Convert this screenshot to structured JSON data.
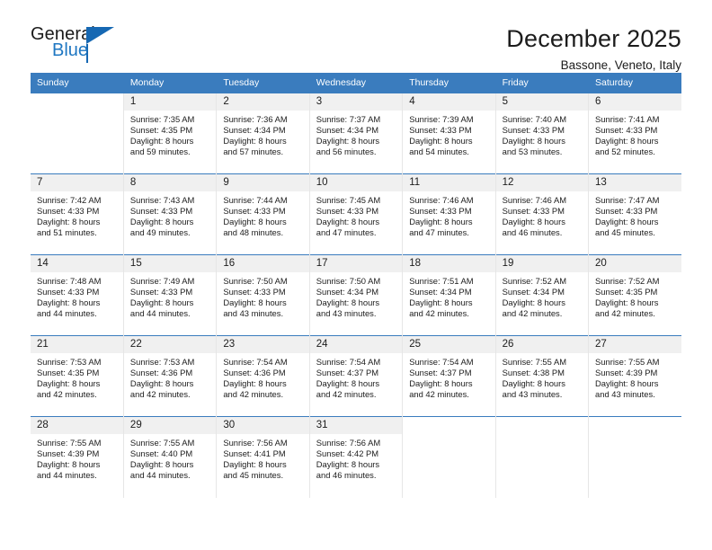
{
  "brand": {
    "name_part1": "General",
    "name_part2": "Blue",
    "triangle_color": "#1668b3",
    "blue_color": "#1f77c2"
  },
  "header": {
    "month_title": "December 2025",
    "location": "Bassone, Veneto, Italy",
    "header_bg": "#3a7cbe",
    "header_text_color": "#ffffff"
  },
  "weekdays": [
    "Sunday",
    "Monday",
    "Tuesday",
    "Wednesday",
    "Thursday",
    "Friday",
    "Saturday"
  ],
  "weeks": [
    [
      {
        "day": "",
        "sunrise": "",
        "sunset": "",
        "daylight1": "",
        "daylight2": ""
      },
      {
        "day": "1",
        "sunrise": "Sunrise: 7:35 AM",
        "sunset": "Sunset: 4:35 PM",
        "daylight1": "Daylight: 8 hours",
        "daylight2": "and 59 minutes."
      },
      {
        "day": "2",
        "sunrise": "Sunrise: 7:36 AM",
        "sunset": "Sunset: 4:34 PM",
        "daylight1": "Daylight: 8 hours",
        "daylight2": "and 57 minutes."
      },
      {
        "day": "3",
        "sunrise": "Sunrise: 7:37 AM",
        "sunset": "Sunset: 4:34 PM",
        "daylight1": "Daylight: 8 hours",
        "daylight2": "and 56 minutes."
      },
      {
        "day": "4",
        "sunrise": "Sunrise: 7:39 AM",
        "sunset": "Sunset: 4:33 PM",
        "daylight1": "Daylight: 8 hours",
        "daylight2": "and 54 minutes."
      },
      {
        "day": "5",
        "sunrise": "Sunrise: 7:40 AM",
        "sunset": "Sunset: 4:33 PM",
        "daylight1": "Daylight: 8 hours",
        "daylight2": "and 53 minutes."
      },
      {
        "day": "6",
        "sunrise": "Sunrise: 7:41 AM",
        "sunset": "Sunset: 4:33 PM",
        "daylight1": "Daylight: 8 hours",
        "daylight2": "and 52 minutes."
      }
    ],
    [
      {
        "day": "7",
        "sunrise": "Sunrise: 7:42 AM",
        "sunset": "Sunset: 4:33 PM",
        "daylight1": "Daylight: 8 hours",
        "daylight2": "and 51 minutes."
      },
      {
        "day": "8",
        "sunrise": "Sunrise: 7:43 AM",
        "sunset": "Sunset: 4:33 PM",
        "daylight1": "Daylight: 8 hours",
        "daylight2": "and 49 minutes."
      },
      {
        "day": "9",
        "sunrise": "Sunrise: 7:44 AM",
        "sunset": "Sunset: 4:33 PM",
        "daylight1": "Daylight: 8 hours",
        "daylight2": "and 48 minutes."
      },
      {
        "day": "10",
        "sunrise": "Sunrise: 7:45 AM",
        "sunset": "Sunset: 4:33 PM",
        "daylight1": "Daylight: 8 hours",
        "daylight2": "and 47 minutes."
      },
      {
        "day": "11",
        "sunrise": "Sunrise: 7:46 AM",
        "sunset": "Sunset: 4:33 PM",
        "daylight1": "Daylight: 8 hours",
        "daylight2": "and 47 minutes."
      },
      {
        "day": "12",
        "sunrise": "Sunrise: 7:46 AM",
        "sunset": "Sunset: 4:33 PM",
        "daylight1": "Daylight: 8 hours",
        "daylight2": "and 46 minutes."
      },
      {
        "day": "13",
        "sunrise": "Sunrise: 7:47 AM",
        "sunset": "Sunset: 4:33 PM",
        "daylight1": "Daylight: 8 hours",
        "daylight2": "and 45 minutes."
      }
    ],
    [
      {
        "day": "14",
        "sunrise": "Sunrise: 7:48 AM",
        "sunset": "Sunset: 4:33 PM",
        "daylight1": "Daylight: 8 hours",
        "daylight2": "and 44 minutes."
      },
      {
        "day": "15",
        "sunrise": "Sunrise: 7:49 AM",
        "sunset": "Sunset: 4:33 PM",
        "daylight1": "Daylight: 8 hours",
        "daylight2": "and 44 minutes."
      },
      {
        "day": "16",
        "sunrise": "Sunrise: 7:50 AM",
        "sunset": "Sunset: 4:33 PM",
        "daylight1": "Daylight: 8 hours",
        "daylight2": "and 43 minutes."
      },
      {
        "day": "17",
        "sunrise": "Sunrise: 7:50 AM",
        "sunset": "Sunset: 4:34 PM",
        "daylight1": "Daylight: 8 hours",
        "daylight2": "and 43 minutes."
      },
      {
        "day": "18",
        "sunrise": "Sunrise: 7:51 AM",
        "sunset": "Sunset: 4:34 PM",
        "daylight1": "Daylight: 8 hours",
        "daylight2": "and 42 minutes."
      },
      {
        "day": "19",
        "sunrise": "Sunrise: 7:52 AM",
        "sunset": "Sunset: 4:34 PM",
        "daylight1": "Daylight: 8 hours",
        "daylight2": "and 42 minutes."
      },
      {
        "day": "20",
        "sunrise": "Sunrise: 7:52 AM",
        "sunset": "Sunset: 4:35 PM",
        "daylight1": "Daylight: 8 hours",
        "daylight2": "and 42 minutes."
      }
    ],
    [
      {
        "day": "21",
        "sunrise": "Sunrise: 7:53 AM",
        "sunset": "Sunset: 4:35 PM",
        "daylight1": "Daylight: 8 hours",
        "daylight2": "and 42 minutes."
      },
      {
        "day": "22",
        "sunrise": "Sunrise: 7:53 AM",
        "sunset": "Sunset: 4:36 PM",
        "daylight1": "Daylight: 8 hours",
        "daylight2": "and 42 minutes."
      },
      {
        "day": "23",
        "sunrise": "Sunrise: 7:54 AM",
        "sunset": "Sunset: 4:36 PM",
        "daylight1": "Daylight: 8 hours",
        "daylight2": "and 42 minutes."
      },
      {
        "day": "24",
        "sunrise": "Sunrise: 7:54 AM",
        "sunset": "Sunset: 4:37 PM",
        "daylight1": "Daylight: 8 hours",
        "daylight2": "and 42 minutes."
      },
      {
        "day": "25",
        "sunrise": "Sunrise: 7:54 AM",
        "sunset": "Sunset: 4:37 PM",
        "daylight1": "Daylight: 8 hours",
        "daylight2": "and 42 minutes."
      },
      {
        "day": "26",
        "sunrise": "Sunrise: 7:55 AM",
        "sunset": "Sunset: 4:38 PM",
        "daylight1": "Daylight: 8 hours",
        "daylight2": "and 43 minutes."
      },
      {
        "day": "27",
        "sunrise": "Sunrise: 7:55 AM",
        "sunset": "Sunset: 4:39 PM",
        "daylight1": "Daylight: 8 hours",
        "daylight2": "and 43 minutes."
      }
    ],
    [
      {
        "day": "28",
        "sunrise": "Sunrise: 7:55 AM",
        "sunset": "Sunset: 4:39 PM",
        "daylight1": "Daylight: 8 hours",
        "daylight2": "and 44 minutes."
      },
      {
        "day": "29",
        "sunrise": "Sunrise: 7:55 AM",
        "sunset": "Sunset: 4:40 PM",
        "daylight1": "Daylight: 8 hours",
        "daylight2": "and 44 minutes."
      },
      {
        "day": "30",
        "sunrise": "Sunrise: 7:56 AM",
        "sunset": "Sunset: 4:41 PM",
        "daylight1": "Daylight: 8 hours",
        "daylight2": "and 45 minutes."
      },
      {
        "day": "31",
        "sunrise": "Sunrise: 7:56 AM",
        "sunset": "Sunset: 4:42 PM",
        "daylight1": "Daylight: 8 hours",
        "daylight2": "and 46 minutes."
      },
      {
        "day": "",
        "sunrise": "",
        "sunset": "",
        "daylight1": "",
        "daylight2": ""
      },
      {
        "day": "",
        "sunrise": "",
        "sunset": "",
        "daylight1": "",
        "daylight2": ""
      },
      {
        "day": "",
        "sunrise": "",
        "sunset": "",
        "daylight1": "",
        "daylight2": ""
      }
    ]
  ]
}
